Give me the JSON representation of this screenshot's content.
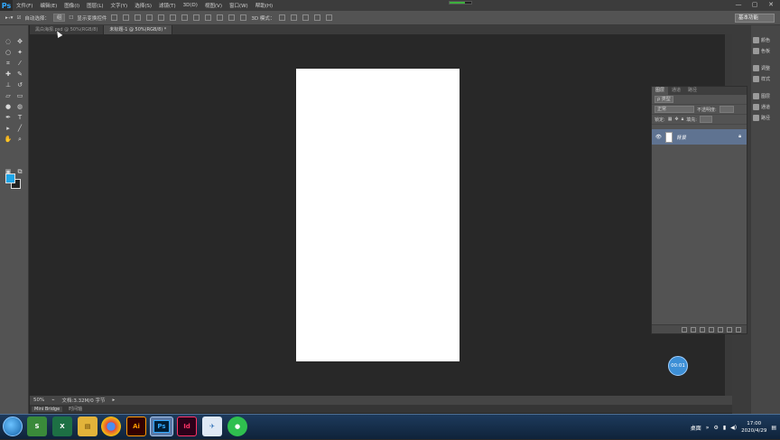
{
  "app": {
    "logo": "Ps",
    "menu": [
      "文件(F)",
      "编辑(E)",
      "图像(I)",
      "图层(L)",
      "文字(Y)",
      "选择(S)",
      "滤镜(T)",
      "3D(D)",
      "视图(V)",
      "窗口(W)",
      "帮助(H)"
    ],
    "window_controls": [
      "—",
      "▢",
      "✕"
    ],
    "loading_progress": 0.7
  },
  "options_bar": {
    "auto_select_label": "自动选择：",
    "auto_select_value": "组",
    "show_transform_label": "显示变换控件",
    "mode_3d_label": "3D 模式：",
    "workspace": "基本功能"
  },
  "tools": [
    "move-icon",
    "marquee-icon",
    "lasso-icon",
    "magic-wand-icon",
    "crop-icon",
    "eyedropper-icon",
    "healing-icon",
    "brush-icon",
    "stamp-icon",
    "history-brush-icon",
    "eraser-icon",
    "gradient-icon",
    "blur-icon",
    "dodge-icon",
    "pen-icon",
    "type-icon",
    "path-select-icon",
    "line-icon",
    "hand-icon",
    "zoom-icon"
  ],
  "colors": {
    "foreground": "#1fa6e8",
    "background": "#222222",
    "layer_selected": "#5f7391",
    "timer": "#3d8fd6"
  },
  "documents": {
    "tabs": [
      "黑白海报.psd @ 50%(RGB/8)",
      "未标题-1 @ 50%(RGB/8) *"
    ],
    "active_index": 1
  },
  "status_bar": {
    "zoom": "50%",
    "doc_info": "文档:3.32M/0 字节"
  },
  "bottom_tabs": [
    "Mini Bridge",
    "时间轴"
  ],
  "panel_strip": {
    "items": [
      "颜色",
      "色板",
      "调整",
      "样式",
      "图层",
      "通道",
      "路径"
    ]
  },
  "layers_panel": {
    "tabs": [
      "图层",
      "通道",
      "路径"
    ],
    "filter_label": "ρ 类型",
    "blend_mode": "正常",
    "opacity_label": "不透明度:",
    "lock_label": "锁定:",
    "fill_label": "填充:",
    "layers": [
      {
        "name": "背景",
        "locked": true
      }
    ]
  },
  "overlay": {
    "timer_text": "00:01"
  },
  "taskbar": {
    "apps": [
      "Excel",
      "Folder",
      "Chrome",
      "Illustrator",
      "Photoshop",
      "InDesign",
      "Bird",
      "Green"
    ],
    "app_labels": [
      "Ai",
      "Ps",
      "Id"
    ],
    "desktop_label": "桌面",
    "time": "17:00",
    "date": "2020/4/29"
  }
}
